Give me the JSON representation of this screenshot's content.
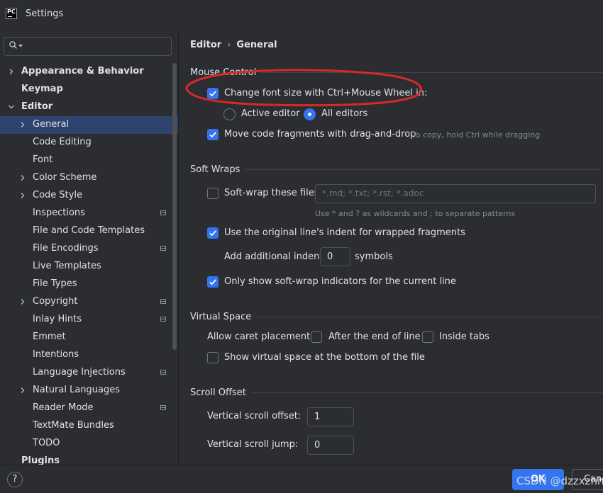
{
  "window": {
    "title": "Settings",
    "logo_text": "PC"
  },
  "sidebar": {
    "search": {
      "placeholder": ""
    },
    "items": [
      {
        "label": "Appearance & Behavior"
      },
      {
        "label": "Keymap"
      },
      {
        "label": "Editor"
      },
      {
        "label": "General"
      },
      {
        "label": "Code Editing"
      },
      {
        "label": "Font"
      },
      {
        "label": "Color Scheme"
      },
      {
        "label": "Code Style"
      },
      {
        "label": "Inspections"
      },
      {
        "label": "File and Code Templates"
      },
      {
        "label": "File Encodings"
      },
      {
        "label": "Live Templates"
      },
      {
        "label": "File Types"
      },
      {
        "label": "Copyright"
      },
      {
        "label": "Inlay Hints"
      },
      {
        "label": "Emmet"
      },
      {
        "label": "Intentions"
      },
      {
        "label": "Language Injections"
      },
      {
        "label": "Natural Languages"
      },
      {
        "label": "Reader Mode"
      },
      {
        "label": "TextMate Bundles"
      },
      {
        "label": "TODO"
      },
      {
        "label": "Plugins"
      }
    ]
  },
  "breadcrumb": {
    "parent": "Editor",
    "separator": "›",
    "current": "General"
  },
  "mouse_control": {
    "header": "Mouse Control",
    "change_font_size": {
      "label": "Change font size with Ctrl+Mouse Wheel in:",
      "checked": true
    },
    "active_editor": {
      "label": "Active editor",
      "selected": false
    },
    "all_editors": {
      "label": "All editors",
      "selected": true
    },
    "drag_drop": {
      "label": "Move code fragments with drag-and-drop",
      "checked": true,
      "hint": "To copy, hold Ctrl while dragging"
    }
  },
  "soft_wraps": {
    "header": "Soft Wraps",
    "soft_wrap_files": {
      "label": "Soft-wrap these files:",
      "checked": false,
      "placeholder": "*.md; *.txt; *.rst; *.adoc",
      "hint": "Use * and ? as wildcards and ; to separate patterns"
    },
    "original_indent": {
      "label": "Use the original line's indent for wrapped fragments",
      "checked": true
    },
    "additional_indent": {
      "label": "Add additional indent:",
      "value": "0",
      "suffix": "symbols"
    },
    "only_current_line": {
      "label": "Only show soft-wrap indicators for the current line",
      "checked": true
    }
  },
  "virtual_space": {
    "header": "Virtual Space",
    "caret_placement_label": "Allow caret placement:",
    "after_end": {
      "label": "After the end of line",
      "checked": false
    },
    "inside_tabs": {
      "label": "Inside tabs",
      "checked": false
    },
    "bottom_of_file": {
      "label": "Show virtual space at the bottom of the file",
      "checked": false
    }
  },
  "scroll_offset": {
    "header": "Scroll Offset",
    "vertical_offset": {
      "label": "Vertical scroll offset:",
      "value": "1"
    },
    "vertical_jump": {
      "label": "Vertical scroll jump:",
      "value": "0"
    }
  },
  "footer": {
    "help": "?",
    "ok": "OK",
    "cancel": "Canc"
  },
  "watermark": "CSDN @dzzxzhh",
  "colors": {
    "accent": "#3574f0",
    "selection": "#2e436e",
    "annotation": "#d42a2a",
    "background": "#2b2d30"
  }
}
